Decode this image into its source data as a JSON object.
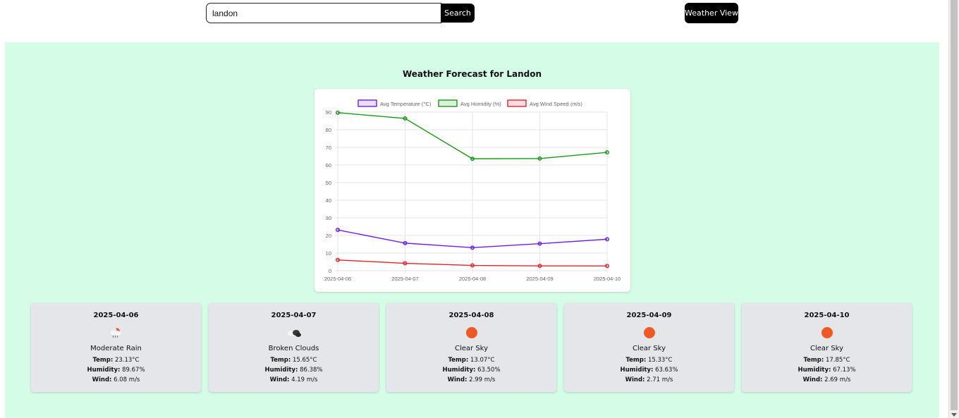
{
  "search": {
    "value": "landon",
    "button_label": "Search"
  },
  "header": {
    "view_button_label": "Weather View"
  },
  "page": {
    "title": "Weather Forecast for Landon"
  },
  "colors": {
    "panel": "#d5fce6",
    "temperature": "#6f1ff0",
    "humidity": "#1a9a1a",
    "wind": "#e3242b",
    "sun": "#ee5a24"
  },
  "chart_data": {
    "type": "line",
    "categories": [
      "2025-04-06",
      "2025-04-07",
      "2025-04-08",
      "2025-04-09",
      "2025-04-10"
    ],
    "series": [
      {
        "name": "Avg Temperature (°C)",
        "values": [
          23.13,
          15.65,
          13.07,
          15.33,
          17.85
        ]
      },
      {
        "name": "Avg Humidity (%)",
        "values": [
          89.67,
          86.38,
          63.5,
          63.63,
          67.13
        ]
      },
      {
        "name": "Avg Wind Speed (m/s)",
        "values": [
          6.08,
          4.19,
          2.99,
          2.71,
          2.69
        ]
      }
    ],
    "ylim": [
      0,
      90
    ],
    "yticks": [
      0,
      10,
      20,
      30,
      40,
      50,
      60,
      70,
      80,
      90
    ],
    "grid": true,
    "legend": "top"
  },
  "forecast": [
    {
      "date": "2025-04-06",
      "icon": "rain-cloud-icon",
      "description": "Moderate Rain",
      "temp_label": "Temp:",
      "temp": "23.13°C",
      "humidity_label": "Humidity:",
      "humidity": "89.67%",
      "wind_label": "Wind:",
      "wind": "6.08 m/s"
    },
    {
      "date": "2025-04-07",
      "icon": "broken-clouds-icon",
      "description": "Broken Clouds",
      "temp_label": "Temp:",
      "temp": "15.65°C",
      "humidity_label": "Humidity:",
      "humidity": "86.38%",
      "wind_label": "Wind:",
      "wind": "4.19 m/s"
    },
    {
      "date": "2025-04-08",
      "icon": "sun-icon",
      "description": "Clear Sky",
      "temp_label": "Temp:",
      "temp": "13.07°C",
      "humidity_label": "Humidity:",
      "humidity": "63.50%",
      "wind_label": "Wind:",
      "wind": "2.99 m/s"
    },
    {
      "date": "2025-04-09",
      "icon": "sun-icon",
      "description": "Clear Sky",
      "temp_label": "Temp:",
      "temp": "15.33°C",
      "humidity_label": "Humidity:",
      "humidity": "63.63%",
      "wind_label": "Wind:",
      "wind": "2.71 m/s"
    },
    {
      "date": "2025-04-10",
      "icon": "sun-icon",
      "description": "Clear Sky",
      "temp_label": "Temp:",
      "temp": "17.85°C",
      "humidity_label": "Humidity:",
      "humidity": "67.13%",
      "wind_label": "Wind:",
      "wind": "2.69 m/s"
    }
  ]
}
